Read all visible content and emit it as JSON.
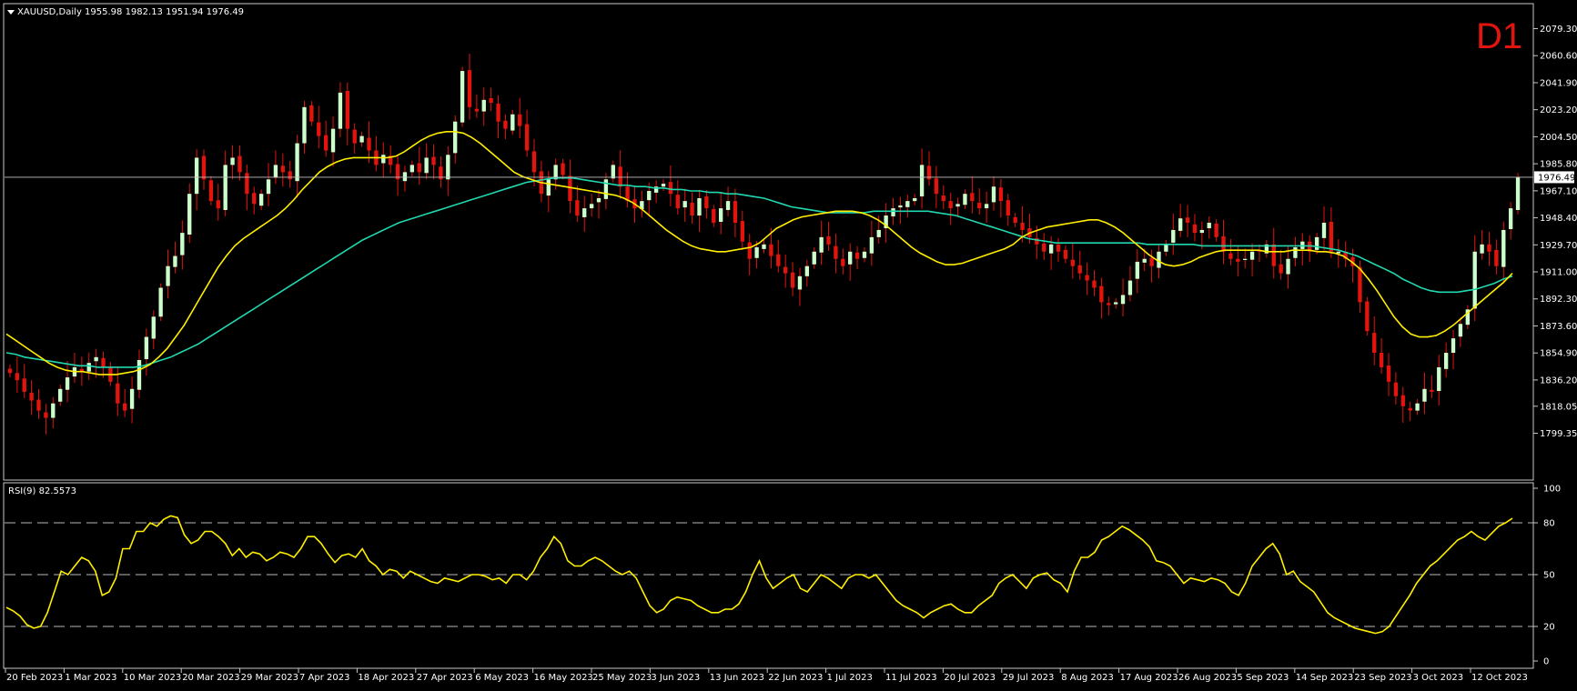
{
  "header": {
    "symbol_line": "XAUUSD,Daily  1955.98 1982.13 1951.94 1976.49",
    "timeframe_badge": "D1",
    "rsi_line": "RSI(9) 82.5573"
  },
  "colors": {
    "background": "#000000",
    "frame": "#c8c8c8",
    "bull_candle": "#ccffcc",
    "bear_candle": "#e3140d",
    "wick": "#e3140d",
    "ma_fast": "#ffee00",
    "ma_slow": "#20d8b0",
    "rsi_line": "#ffee00",
    "rsi_levels": "#b8b8b8",
    "price_line": "#c0c0c0"
  },
  "chart_data": [
    {
      "type": "candlestick",
      "symbol": "XAUUSD",
      "timeframe": "Daily",
      "ylim": [
        1799.35,
        2085.0
      ],
      "price_ticks": [
        "2079.30",
        "2060.60",
        "2041.90",
        "2023.20",
        "2004.50",
        "1985.80",
        "1967.10",
        "1948.40",
        "1929.70",
        "1911.00",
        "1892.30",
        "1873.60",
        "1854.90",
        "1836.20",
        "1818.05",
        "1799.35"
      ],
      "current_price": "1976.49",
      "x_labels": [
        "20 Feb 2023",
        "1 Mar 2023",
        "10 Mar 2023",
        "20 Mar 2023",
        "29 Mar 2023",
        "7 Apr 2023",
        "18 Apr 2023",
        "27 Apr 2023",
        "6 May 2023",
        "16 May 2023",
        "25 May 2023",
        "3 Jun 2023",
        "13 Jun 2023",
        "22 Jun 2023",
        "1 Jul 2023",
        "11 Jul 2023",
        "20 Jul 2023",
        "29 Jul 2023",
        "8 Aug 2023",
        "17 Aug 2023",
        "26 Aug 2023",
        "5 Sep 2023",
        "14 Sep 2023",
        "23 Sep 2023",
        "3 Oct 2023",
        "12 Oct 2023"
      ],
      "close_path": [
        1841,
        1836,
        1828,
        1822,
        1815,
        1810,
        1820,
        1830,
        1838,
        1845,
        1842,
        1848,
        1852,
        1845,
        1835,
        1820,
        1815,
        1830,
        1850,
        1866,
        1880,
        1900,
        1915,
        1922,
        1938,
        1965,
        1990,
        1975,
        1960,
        1955,
        1985,
        1990,
        1980,
        1965,
        1958,
        1965,
        1975,
        1985,
        1980,
        1975,
        2000,
        2025,
        2015,
        2005,
        1995,
        2010,
        2035,
        2010,
        2000,
        2005,
        1995,
        1985,
        1992,
        1985,
        1975,
        1980,
        1985,
        1980,
        1990,
        1985,
        1975,
        1992,
        2015,
        2050,
        2025,
        2022,
        2030,
        2028,
        2015,
        2010,
        2020,
        2012,
        1995,
        1980,
        1965,
        1975,
        1985,
        1978,
        1960,
        1950,
        1955,
        1958,
        1962,
        1975,
        1985,
        1970,
        1960,
        1955,
        1960,
        1967,
        1970,
        1972,
        1965,
        1955,
        1960,
        1950,
        1962,
        1955,
        1945,
        1955,
        1960,
        1945,
        1932,
        1920,
        1928,
        1930,
        1922,
        1915,
        1910,
        1900,
        1908,
        1915,
        1925,
        1935,
        1930,
        1920,
        1915,
        1925,
        1920,
        1925,
        1935,
        1940,
        1950,
        1955,
        1957,
        1960,
        1962,
        1985,
        1975,
        1965,
        1960,
        1955,
        1958,
        1965,
        1960,
        1955,
        1958,
        1970,
        1960,
        1950,
        1945,
        1940,
        1935,
        1930,
        1925,
        1930,
        1925,
        1920,
        1915,
        1910,
        1905,
        1900,
        1890,
        1888,
        1890,
        1895,
        1905,
        1918,
        1920,
        1915,
        1925,
        1930,
        1940,
        1948,
        1945,
        1938,
        1940,
        1945,
        1935,
        1925,
        1920,
        1918,
        1920,
        1925,
        1925,
        1930,
        1915,
        1910,
        1920,
        1928,
        1932,
        1925,
        1935,
        1945,
        1925,
        1925,
        1920,
        1915,
        1890,
        1870,
        1855,
        1845,
        1835,
        1825,
        1818,
        1815,
        1820,
        1830,
        1828,
        1845,
        1855,
        1865,
        1875,
        1885,
        1925,
        1930,
        1925,
        1915,
        1940,
        1955,
        1976.49
      ],
      "ma_fast_path": [
        1868,
        1864,
        1860,
        1856,
        1852,
        1848,
        1845,
        1843,
        1842,
        1842,
        1841,
        1840,
        1840,
        1840,
        1841,
        1842,
        1844,
        1847,
        1852,
        1858,
        1866,
        1874,
        1884,
        1894,
        1904,
        1914,
        1922,
        1929,
        1934,
        1938,
        1942,
        1946,
        1950,
        1955,
        1961,
        1968,
        1974,
        1980,
        1984,
        1987,
        1989,
        1990,
        1990,
        1990,
        1990,
        1990,
        1991,
        1994,
        1998,
        2002,
        2005,
        2007,
        2008,
        2008,
        2007,
        2004,
        2000,
        1995,
        1990,
        1985,
        1980,
        1977,
        1975,
        1973,
        1972,
        1971,
        1970,
        1969,
        1968,
        1967,
        1966,
        1965,
        1964,
        1962,
        1959,
        1955,
        1950,
        1945,
        1940,
        1936,
        1932,
        1929,
        1927,
        1926,
        1925,
        1925,
        1926,
        1927,
        1928,
        1931,
        1936,
        1941,
        1944,
        1947,
        1949,
        1950,
        1951,
        1952,
        1953,
        1953,
        1953,
        1952,
        1950,
        1947,
        1943,
        1938,
        1933,
        1928,
        1924,
        1921,
        1918,
        1916,
        1916,
        1917,
        1919,
        1921,
        1923,
        1925,
        1927,
        1930,
        1935,
        1938,
        1940,
        1942,
        1943,
        1944,
        1945,
        1946,
        1947,
        1947,
        1945,
        1942,
        1938,
        1933,
        1928,
        1923,
        1919,
        1916,
        1915,
        1916,
        1918,
        1921,
        1923,
        1925,
        1926,
        1926,
        1926,
        1926,
        1926,
        1925,
        1925,
        1925,
        1926,
        1926,
        1926,
        1925,
        1925,
        1924,
        1922,
        1918,
        1913,
        1906,
        1898,
        1889,
        1880,
        1873,
        1868,
        1866,
        1866,
        1867,
        1870,
        1874,
        1879,
        1884,
        1889,
        1894,
        1899,
        1904,
        1910
      ],
      "ma_slow_path": [
        1855,
        1854,
        1852,
        1851,
        1850,
        1849,
        1848,
        1847,
        1846,
        1846,
        1845,
        1845,
        1845,
        1845,
        1845,
        1846,
        1848,
        1850,
        1852,
        1855,
        1858,
        1861,
        1865,
        1869,
        1873,
        1877,
        1881,
        1885,
        1889,
        1893,
        1897,
        1901,
        1905,
        1909,
        1913,
        1917,
        1921,
        1925,
        1929,
        1933,
        1936,
        1939,
        1942,
        1945,
        1947,
        1949,
        1951,
        1953,
        1955,
        1957,
        1959,
        1961,
        1963,
        1965,
        1967,
        1969,
        1971,
        1973,
        1974,
        1975,
        1976,
        1976,
        1976,
        1975,
        1974,
        1973,
        1972,
        1971,
        1971,
        1970,
        1970,
        1969,
        1969,
        1968,
        1968,
        1967,
        1967,
        1966,
        1966,
        1965,
        1965,
        1964,
        1963,
        1962,
        1960,
        1958,
        1956,
        1955,
        1954,
        1953,
        1952,
        1952,
        1952,
        1952,
        1952,
        1953,
        1953,
        1953,
        1953,
        1953,
        1953,
        1953,
        1952,
        1951,
        1950,
        1948,
        1946,
        1944,
        1942,
        1940,
        1938,
        1936,
        1934,
        1933,
        1932,
        1931,
        1931,
        1931,
        1931,
        1931,
        1931,
        1931,
        1931,
        1931,
        1931,
        1930,
        1930,
        1930,
        1930,
        1930,
        1930,
        1929,
        1929,
        1929,
        1929,
        1929,
        1929,
        1929,
        1929,
        1929,
        1929,
        1929,
        1929,
        1929,
        1928,
        1927,
        1926,
        1924,
        1922,
        1919,
        1916,
        1913,
        1910,
        1906,
        1903,
        1900,
        1898,
        1897,
        1897,
        1897,
        1898,
        1899,
        1901,
        1903,
        1906,
        1908
      ]
    },
    {
      "type": "line",
      "indicator": "RSI(9)",
      "value": "82.5573",
      "ylim": [
        0,
        100
      ],
      "y_ticks": [
        "100",
        "80",
        "50",
        "20",
        "0"
      ],
      "levels": [
        80,
        50,
        20
      ],
      "rsi_path": [
        31,
        29,
        26,
        21,
        19,
        20,
        28,
        40,
        52,
        50,
        55,
        60,
        58,
        52,
        38,
        40,
        48,
        65,
        65,
        75,
        75,
        80,
        78,
        82,
        84,
        83,
        73,
        68,
        70,
        75,
        75,
        72,
        68,
        61,
        65,
        60,
        63,
        62,
        58,
        60,
        63,
        62,
        60,
        65,
        72,
        72,
        68,
        62,
        57,
        61,
        62,
        60,
        65,
        58,
        55,
        50,
        53,
        52,
        48,
        52,
        50,
        48,
        46,
        45,
        48,
        47,
        46,
        48,
        50,
        50,
        49,
        47,
        48,
        45,
        50,
        50,
        47,
        52,
        60,
        65,
        72,
        68,
        58,
        55,
        55,
        58,
        60,
        58,
        55,
        52,
        50,
        52,
        48,
        40,
        32,
        28,
        30,
        35,
        37,
        36,
        35,
        32,
        30,
        28,
        28,
        30,
        30,
        33,
        40,
        50,
        58,
        48,
        42,
        45,
        48,
        50,
        42,
        40,
        45,
        50,
        48,
        45,
        42,
        48,
        50,
        50,
        48,
        50,
        45,
        40,
        35,
        32,
        30,
        28,
        25,
        28,
        30,
        32,
        33,
        30,
        28,
        28,
        32,
        35,
        38,
        45,
        48,
        50,
        46,
        42,
        48,
        50,
        51,
        47,
        45,
        40,
        52,
        60,
        60,
        63,
        70,
        72,
        75,
        78,
        76,
        73,
        70,
        66,
        58,
        57,
        55,
        50,
        45,
        48,
        47,
        46,
        48,
        47,
        45,
        40,
        38,
        45,
        55,
        60,
        65,
        68,
        62,
        50,
        52,
        46,
        43,
        40,
        34,
        28,
        25,
        23,
        21,
        19,
        18,
        17,
        16,
        17,
        20,
        26,
        32,
        38,
        45,
        50,
        55,
        58,
        62,
        66,
        70,
        72,
        75,
        72,
        70,
        74,
        78,
        80,
        82.56
      ]
    }
  ]
}
